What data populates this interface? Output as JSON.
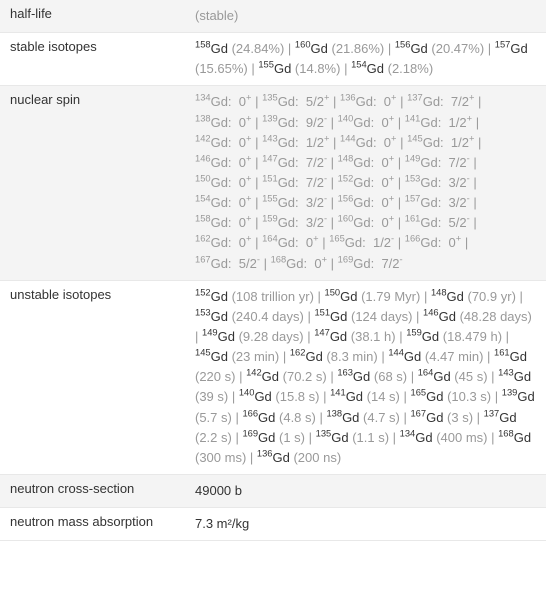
{
  "rows": {
    "half_life": {
      "label": "half-life",
      "value": "(stable)"
    },
    "stable_isotopes": {
      "label": "stable isotopes",
      "entries": [
        {
          "mass": "158",
          "el": "Gd",
          "note": "(24.84%)"
        },
        {
          "mass": "160",
          "el": "Gd",
          "note": "(21.86%)"
        },
        {
          "mass": "156",
          "el": "Gd",
          "note": "(20.47%)"
        },
        {
          "mass": "157",
          "el": "Gd",
          "note": "(15.65%)"
        },
        {
          "mass": "155",
          "el": "Gd",
          "note": "(14.8%)"
        },
        {
          "mass": "154",
          "el": "Gd",
          "note": "(2.18%)"
        }
      ]
    },
    "nuclear_spin": {
      "label": "nuclear spin",
      "entries": [
        {
          "mass": "134",
          "el": "Gd",
          "spin_base": "0",
          "spin_sup": "+"
        },
        {
          "mass": "135",
          "el": "Gd",
          "spin_base": "5/2",
          "spin_sup": "+"
        },
        {
          "mass": "136",
          "el": "Gd",
          "spin_base": "0",
          "spin_sup": "+"
        },
        {
          "mass": "137",
          "el": "Gd",
          "spin_base": "7/2",
          "spin_sup": "+"
        },
        {
          "mass": "138",
          "el": "Gd",
          "spin_base": "0",
          "spin_sup": "+"
        },
        {
          "mass": "139",
          "el": "Gd",
          "spin_base": "9/2",
          "spin_sup": "-"
        },
        {
          "mass": "140",
          "el": "Gd",
          "spin_base": "0",
          "spin_sup": "+"
        },
        {
          "mass": "141",
          "el": "Gd",
          "spin_base": "1/2",
          "spin_sup": "+"
        },
        {
          "mass": "142",
          "el": "Gd",
          "spin_base": "0",
          "spin_sup": "+"
        },
        {
          "mass": "143",
          "el": "Gd",
          "spin_base": "1/2",
          "spin_sup": "+"
        },
        {
          "mass": "144",
          "el": "Gd",
          "spin_base": "0",
          "spin_sup": "+"
        },
        {
          "mass": "145",
          "el": "Gd",
          "spin_base": "1/2",
          "spin_sup": "+"
        },
        {
          "mass": "146",
          "el": "Gd",
          "spin_base": "0",
          "spin_sup": "+"
        },
        {
          "mass": "147",
          "el": "Gd",
          "spin_base": "7/2",
          "spin_sup": "-"
        },
        {
          "mass": "148",
          "el": "Gd",
          "spin_base": "0",
          "spin_sup": "+"
        },
        {
          "mass": "149",
          "el": "Gd",
          "spin_base": "7/2",
          "spin_sup": "-"
        },
        {
          "mass": "150",
          "el": "Gd",
          "spin_base": "0",
          "spin_sup": "+"
        },
        {
          "mass": "151",
          "el": "Gd",
          "spin_base": "7/2",
          "spin_sup": "-"
        },
        {
          "mass": "152",
          "el": "Gd",
          "spin_base": "0",
          "spin_sup": "+"
        },
        {
          "mass": "153",
          "el": "Gd",
          "spin_base": "3/2",
          "spin_sup": "-"
        },
        {
          "mass": "154",
          "el": "Gd",
          "spin_base": "0",
          "spin_sup": "+"
        },
        {
          "mass": "155",
          "el": "Gd",
          "spin_base": "3/2",
          "spin_sup": "-"
        },
        {
          "mass": "156",
          "el": "Gd",
          "spin_base": "0",
          "spin_sup": "+"
        },
        {
          "mass": "157",
          "el": "Gd",
          "spin_base": "3/2",
          "spin_sup": "-"
        },
        {
          "mass": "158",
          "el": "Gd",
          "spin_base": "0",
          "spin_sup": "+"
        },
        {
          "mass": "159",
          "el": "Gd",
          "spin_base": "3/2",
          "spin_sup": "-"
        },
        {
          "mass": "160",
          "el": "Gd",
          "spin_base": "0",
          "spin_sup": "+"
        },
        {
          "mass": "161",
          "el": "Gd",
          "spin_base": "5/2",
          "spin_sup": "-"
        },
        {
          "mass": "162",
          "el": "Gd",
          "spin_base": "0",
          "spin_sup": "+"
        },
        {
          "mass": "164",
          "el": "Gd",
          "spin_base": "0",
          "spin_sup": "+"
        },
        {
          "mass": "165",
          "el": "Gd",
          "spin_base": "1/2",
          "spin_sup": "-"
        },
        {
          "mass": "166",
          "el": "Gd",
          "spin_base": "0",
          "spin_sup": "+"
        },
        {
          "mass": "167",
          "el": "Gd",
          "spin_base": "5/2",
          "spin_sup": "-"
        },
        {
          "mass": "168",
          "el": "Gd",
          "spin_base": "0",
          "spin_sup": "+"
        },
        {
          "mass": "169",
          "el": "Gd",
          "spin_base": "7/2",
          "spin_sup": "-"
        }
      ]
    },
    "unstable_isotopes": {
      "label": "unstable isotopes",
      "entries": [
        {
          "mass": "152",
          "el": "Gd",
          "note": "(108 trillion yr)"
        },
        {
          "mass": "150",
          "el": "Gd",
          "note": "(1.79 Myr)"
        },
        {
          "mass": "148",
          "el": "Gd",
          "note": "(70.9 yr)"
        },
        {
          "mass": "153",
          "el": "Gd",
          "note": "(240.4 days)"
        },
        {
          "mass": "151",
          "el": "Gd",
          "note": "(124 days)"
        },
        {
          "mass": "146",
          "el": "Gd",
          "note": "(48.28 days)"
        },
        {
          "mass": "149",
          "el": "Gd",
          "note": "(9.28 days)"
        },
        {
          "mass": "147",
          "el": "Gd",
          "note": "(38.1 h)"
        },
        {
          "mass": "159",
          "el": "Gd",
          "note": "(18.479 h)"
        },
        {
          "mass": "145",
          "el": "Gd",
          "note": "(23 min)"
        },
        {
          "mass": "162",
          "el": "Gd",
          "note": "(8.3 min)"
        },
        {
          "mass": "144",
          "el": "Gd",
          "note": "(4.47 min)"
        },
        {
          "mass": "161",
          "el": "Gd",
          "note": "(220 s)"
        },
        {
          "mass": "142",
          "el": "Gd",
          "note": "(70.2 s)"
        },
        {
          "mass": "163",
          "el": "Gd",
          "note": "(68 s)"
        },
        {
          "mass": "164",
          "el": "Gd",
          "note": "(45 s)"
        },
        {
          "mass": "143",
          "el": "Gd",
          "note": "(39 s)"
        },
        {
          "mass": "140",
          "el": "Gd",
          "note": "(15.8 s)"
        },
        {
          "mass": "141",
          "el": "Gd",
          "note": "(14 s)"
        },
        {
          "mass": "165",
          "el": "Gd",
          "note": "(10.3 s)"
        },
        {
          "mass": "139",
          "el": "Gd",
          "note": "(5.7 s)"
        },
        {
          "mass": "166",
          "el": "Gd",
          "note": "(4.8 s)"
        },
        {
          "mass": "138",
          "el": "Gd",
          "note": "(4.7 s)"
        },
        {
          "mass": "167",
          "el": "Gd",
          "note": "(3 s)"
        },
        {
          "mass": "137",
          "el": "Gd",
          "note": "(2.2 s)"
        },
        {
          "mass": "169",
          "el": "Gd",
          "note": "(1 s)"
        },
        {
          "mass": "135",
          "el": "Gd",
          "note": "(1.1 s)"
        },
        {
          "mass": "134",
          "el": "Gd",
          "note": "(400 ms)"
        },
        {
          "mass": "168",
          "el": "Gd",
          "note": "(300 ms)"
        },
        {
          "mass": "136",
          "el": "Gd",
          "note": "(200 ns)"
        }
      ]
    },
    "neutron_cross_section": {
      "label": "neutron cross-section",
      "value": "49000 b"
    },
    "neutron_mass_absorption": {
      "label": "neutron mass absorption",
      "value": "7.3 m²/kg"
    }
  },
  "separator": " | "
}
